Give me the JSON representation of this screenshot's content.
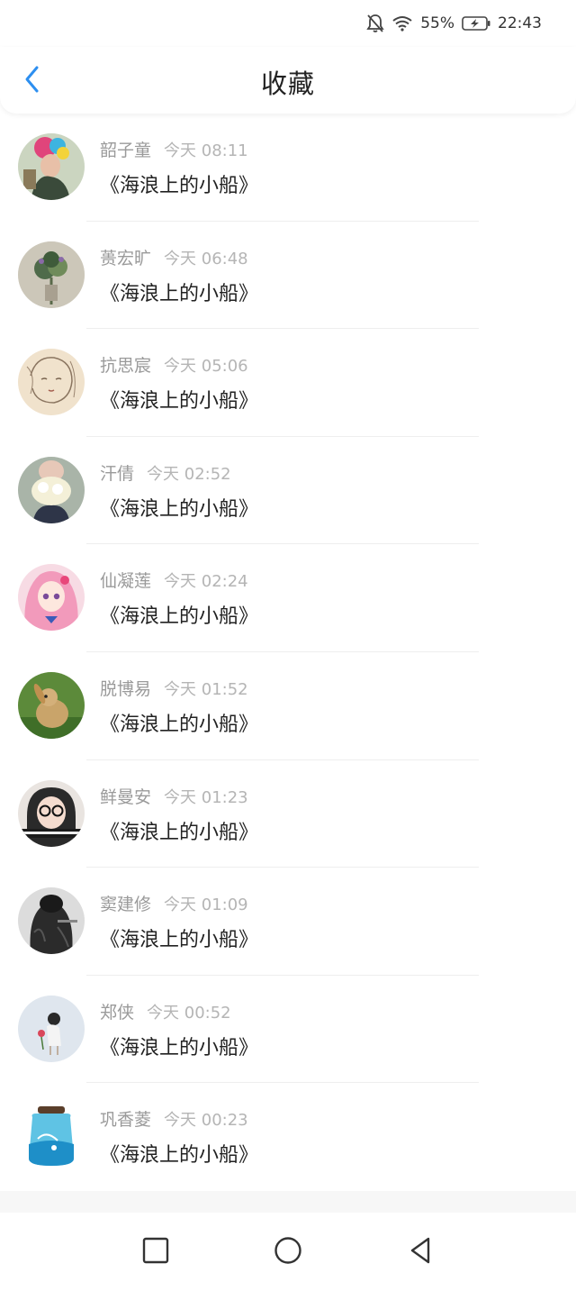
{
  "status_bar": {
    "battery_percent": "55%",
    "time": "22:43",
    "icons": [
      "bell-muted-icon",
      "wifi-icon",
      "battery-charging-icon"
    ]
  },
  "header": {
    "title": "收藏",
    "back_icon": "chevron-left-icon",
    "accent_color": "#2d8ff0"
  },
  "favorites": [
    {
      "name": "韶子童",
      "time": "今天 08:11",
      "text": "《海浪上的小船》"
    },
    {
      "name": "蒉宏旷",
      "time": "今天 06:48",
      "text": "《海浪上的小船》"
    },
    {
      "name": "抗思宸",
      "time": "今天 05:06",
      "text": "《海浪上的小船》"
    },
    {
      "name": "汗倩",
      "time": "今天 02:52",
      "text": "《海浪上的小船》"
    },
    {
      "name": "仙凝莲",
      "time": "今天 02:24",
      "text": "《海浪上的小船》"
    },
    {
      "name": "脱博易",
      "time": "今天 01:52",
      "text": "《海浪上的小船》"
    },
    {
      "name": "鲜曼安",
      "time": "今天 01:23",
      "text": "《海浪上的小船》"
    },
    {
      "name": "窦建修",
      "time": "今天 01:09",
      "text": "《海浪上的小船》"
    },
    {
      "name": "郑侠",
      "time": "今天 00:52",
      "text": "《海浪上的小船》"
    },
    {
      "name": "巩香菱",
      "time": "今天 00:23",
      "text": "《海浪上的小船》"
    }
  ],
  "nav_bar": {
    "buttons": [
      "recent-apps-icon",
      "home-icon",
      "back-triangle-icon"
    ]
  }
}
